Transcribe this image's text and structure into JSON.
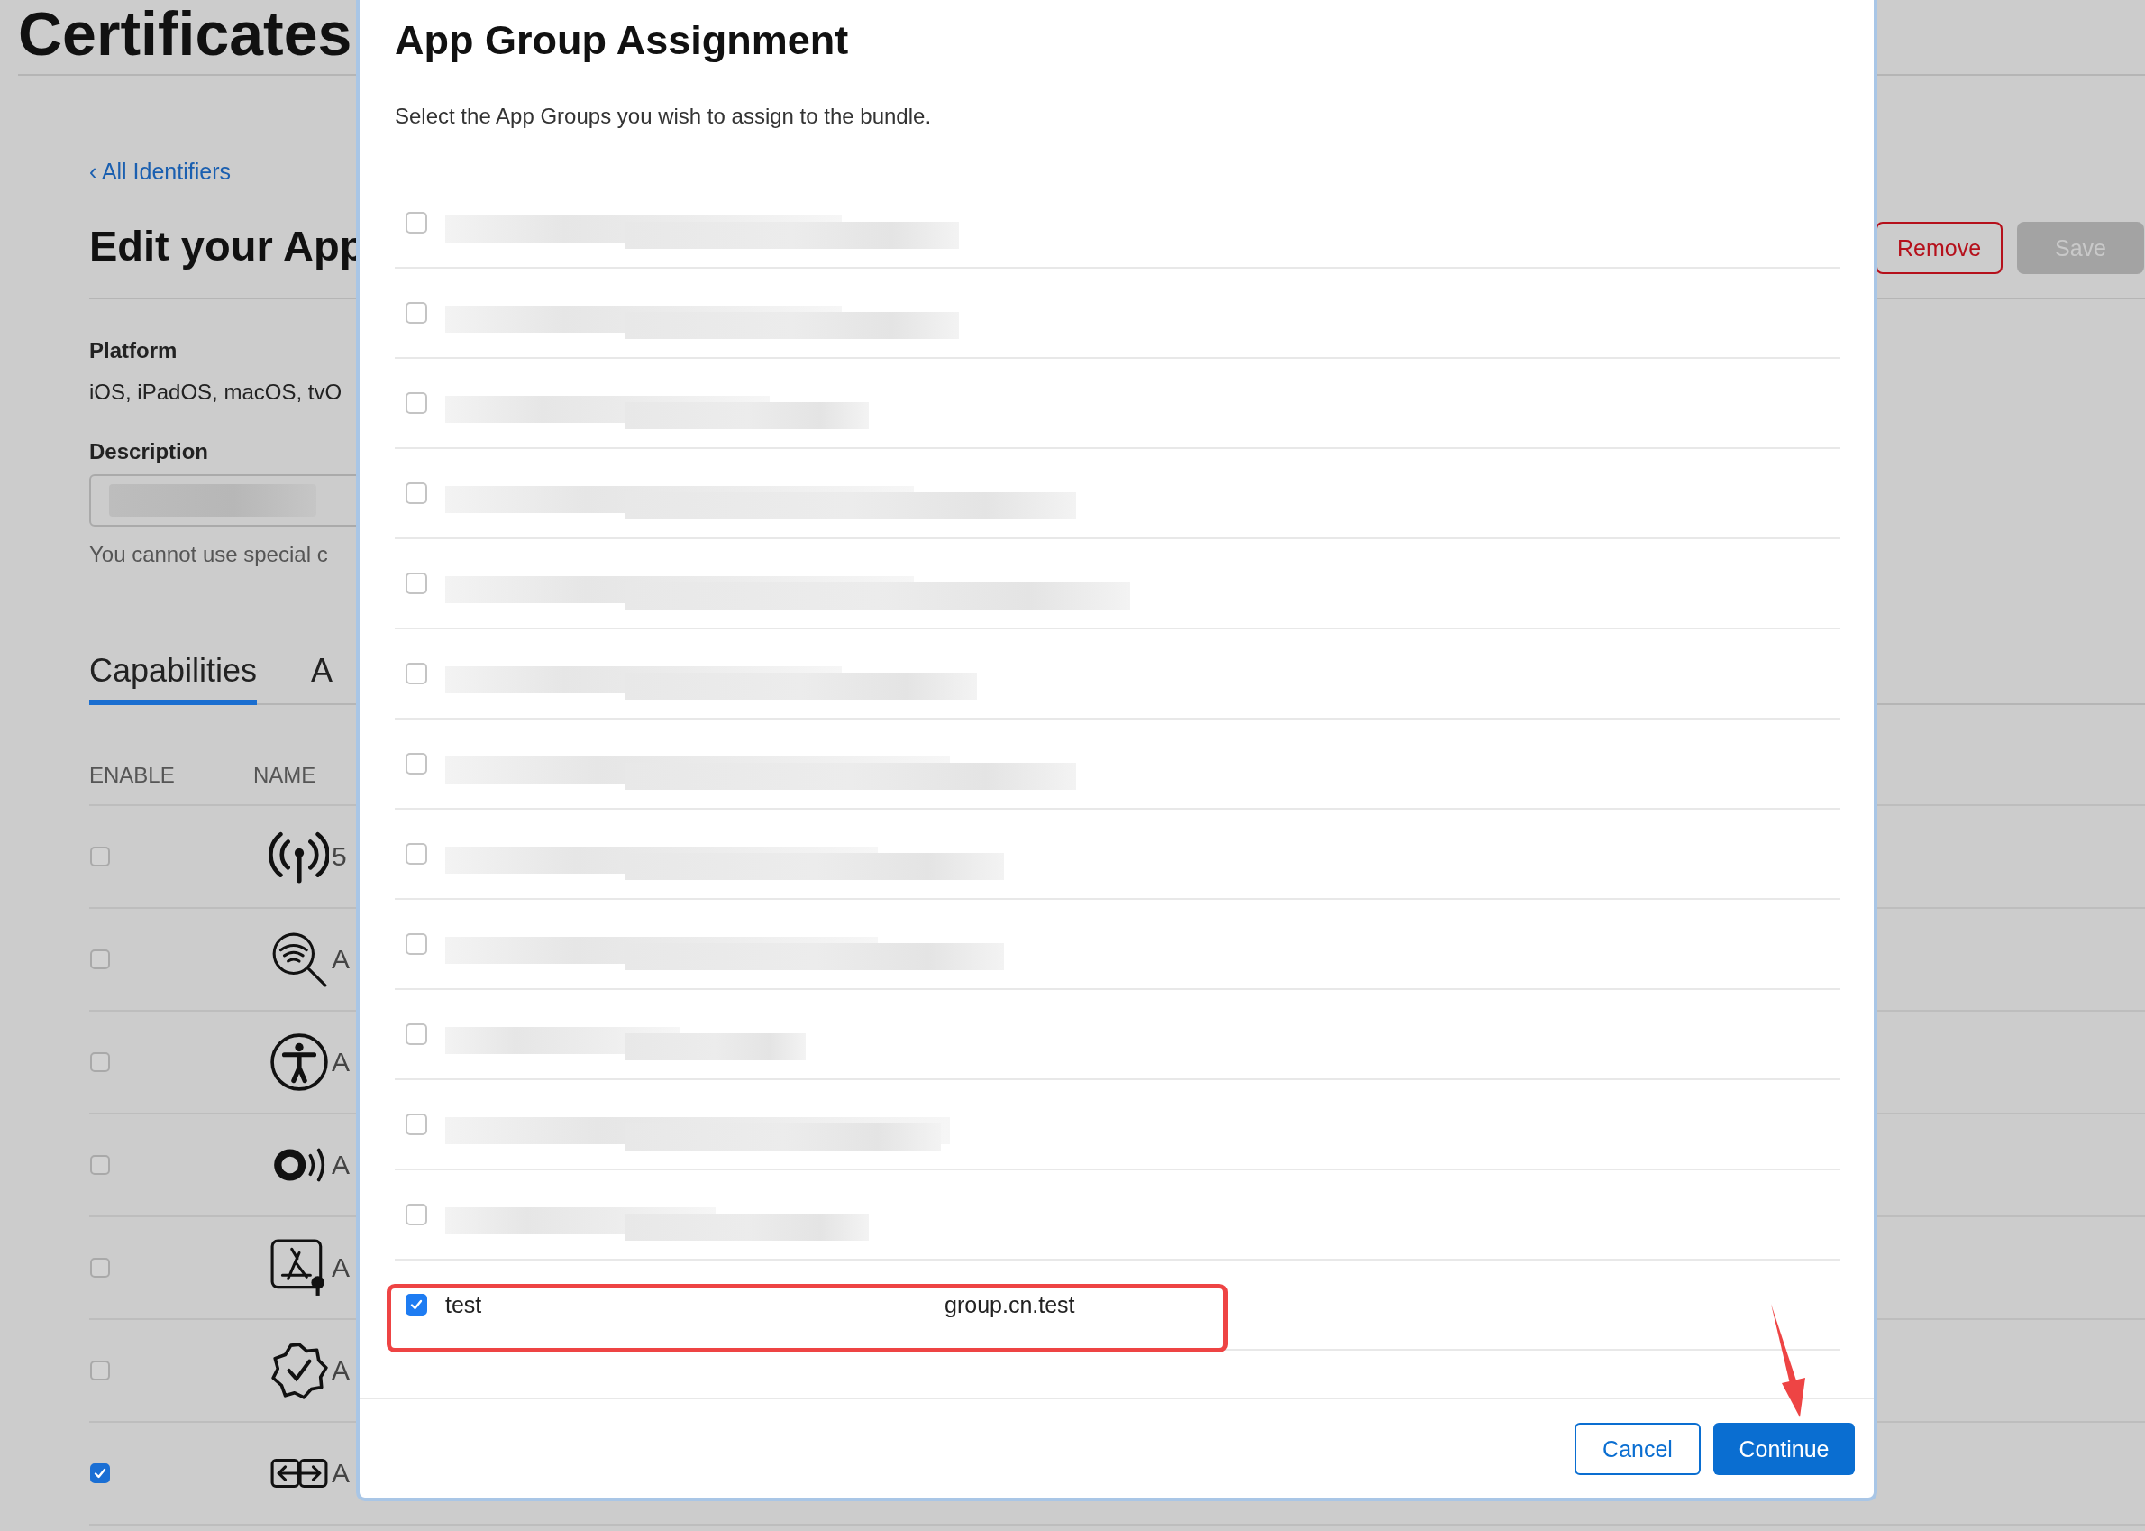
{
  "page": {
    "title": "Certificates",
    "back_link": "‹ All Identifiers",
    "heading": "Edit your App",
    "actions": [
      {
        "label": "Remove",
        "kind": "danger"
      },
      {
        "label": "Save",
        "kind": "primary",
        "disabled": true
      }
    ],
    "platform": {
      "label": "Platform",
      "value": "iOS, iPadOS, macOS, tvO"
    },
    "description": {
      "label": "Description",
      "redacted": true,
      "hint": "You cannot use special c"
    },
    "tabs": [
      {
        "label": "Capabilities",
        "selected": true
      },
      {
        "label": "A",
        "selected": false
      }
    ],
    "table": {
      "columns": [
        "ENABLE",
        "NAME"
      ],
      "rows": [
        {
          "kind": "antenna",
          "checked": false,
          "name": "5"
        },
        {
          "kind": "wifi-search",
          "checked": false,
          "name": "A"
        },
        {
          "kind": "accessibility",
          "checked": false,
          "name": "A"
        },
        {
          "kind": "ring-sound",
          "checked": false,
          "name": "A"
        },
        {
          "kind": "app-key",
          "checked": false,
          "name": "A"
        },
        {
          "kind": "seal-check",
          "checked": false,
          "name": "A"
        },
        {
          "kind": "arrows-box",
          "checked": true,
          "name": "A"
        }
      ]
    }
  },
  "dialog": {
    "title": "App Group Assignment",
    "subtitle": "Select the App Groups you wish to assign to the bundle.",
    "groups": [
      {
        "redacted": true,
        "checked": false,
        "highlighted": false
      },
      {
        "redacted": true,
        "checked": false,
        "highlighted": false
      },
      {
        "redacted": true,
        "checked": false,
        "highlighted": false
      },
      {
        "redacted": true,
        "checked": false,
        "highlighted": false
      },
      {
        "redacted": true,
        "checked": false,
        "highlighted": false
      },
      {
        "redacted": true,
        "checked": false,
        "highlighted": false
      },
      {
        "redacted": true,
        "checked": false,
        "highlighted": false
      },
      {
        "redacted": true,
        "checked": false,
        "highlighted": false
      },
      {
        "redacted": true,
        "checked": false,
        "highlighted": false
      },
      {
        "redacted": true,
        "checked": false,
        "highlighted": false
      },
      {
        "redacted": true,
        "checked": false,
        "highlighted": false
      },
      {
        "redacted": true,
        "checked": false,
        "highlighted": false
      },
      {
        "redacted": false,
        "name": "test",
        "identifier": "group.cn.test",
        "checked": true,
        "highlighted": true
      }
    ],
    "buttons": [
      {
        "label": "Cancel",
        "kind": "secondary"
      },
      {
        "label": "Continue",
        "kind": "primary"
      }
    ],
    "pointer_arrow": true
  }
}
